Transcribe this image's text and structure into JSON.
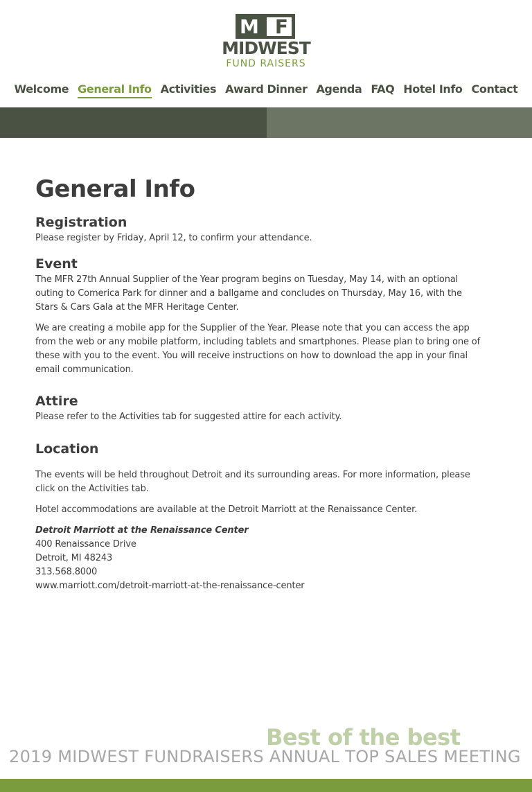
{
  "brand": {
    "logo_mark": "MF",
    "logo_mark_m": "M",
    "logo_mark_f": "F",
    "name": "MIDWEST",
    "tagline": "FUND RAISERS"
  },
  "nav": {
    "items": [
      {
        "label": "Welcome"
      },
      {
        "label": "General Info",
        "active": true
      },
      {
        "label": "Activities"
      },
      {
        "label": "Award Dinner"
      },
      {
        "label": "Agenda"
      },
      {
        "label": "FAQ"
      },
      {
        "label": "Hotel Info"
      },
      {
        "label": "Contact"
      }
    ]
  },
  "page": {
    "title": "General Info",
    "registration": {
      "heading": "Registration",
      "text": "Please register by Friday, April 12, to confirm your attendance."
    },
    "event": {
      "heading": "Event",
      "paragraphs": [
        "The MFR 27th Annual Supplier of the Year program begins on Tuesday, May 14, with an optional outing to Comerica Park for dinner and a ballgame and concludes on Thursday, May 16, with the Stars & Cars Gala at the MFR Heritage Center.",
        "We are creating a mobile app for the Supplier of the Year. Please note that you can access the app from the web or any mobile platform, including tablets and smartphones. Please plan to bring one of these with you to the event. You will receive instructions on how to download the app in your final email communication."
      ]
    },
    "attire": {
      "heading": "Attire",
      "text": "Please refer to the Activities tab for suggested attire for each activity."
    },
    "location": {
      "heading": "Location",
      "paragraphs": [
        "The events will be held throughout Detroit and its surrounding areas. For more information, please click on the Activities tab.",
        "Hotel accommodations are available at the Detroit Marriott at the Renaissance Center."
      ],
      "address": {
        "name": "Detroit Marriott at the Renaissance Center",
        "street": "400 Renaissance Drive",
        "city": "Detroit, MI 48243",
        "phone": "313.568.8000",
        "url": "www.marriott.com/detroit-marriott-at-the-renaissance-center"
      }
    }
  },
  "footer": {
    "slogan": "Best of the best",
    "meeting": "2019 MIDWEST FUNDRAISERS ANNUAL TOP SALES MEETING"
  },
  "colors": {
    "dark_olive": "#4a5243",
    "gray_olive": "#6c7564",
    "accent_green": "#7a9c3c",
    "light_green": "#bfcfa6",
    "footer_gray": "#a7a7a7"
  }
}
